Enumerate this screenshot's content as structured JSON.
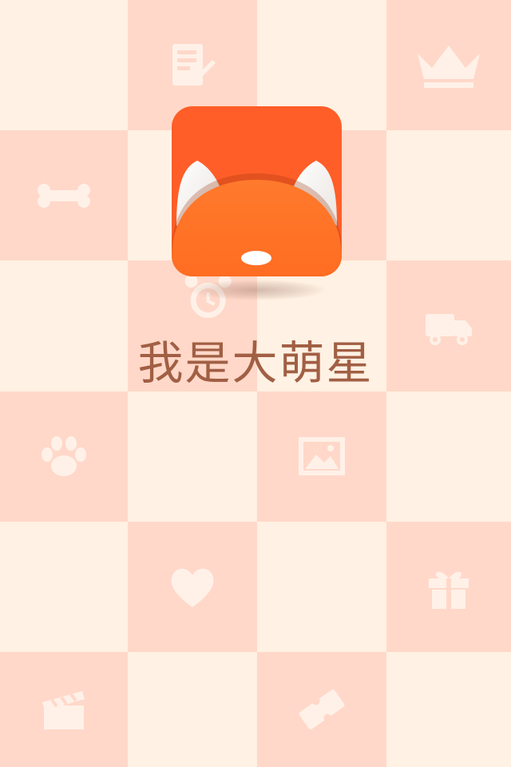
{
  "app": {
    "title": "我是大萌星",
    "logo": "fox-face-icon"
  },
  "colors": {
    "background_light": "#fff1e3",
    "background_pink": "#ffd8c9",
    "pattern_icon": "#fff1e8",
    "logo_orange": "#ff5e28",
    "logo_face": "#ff7526",
    "title_text": "#a15f44"
  },
  "background_pattern": {
    "icons": [
      "book-icon",
      "crown-icon",
      "bone-icon",
      "alarm-clock-icon",
      "truck-icon",
      "paw-icon",
      "picture-icon",
      "heart-icon",
      "gift-icon",
      "clapperboard-icon",
      "ticket-icon"
    ]
  }
}
